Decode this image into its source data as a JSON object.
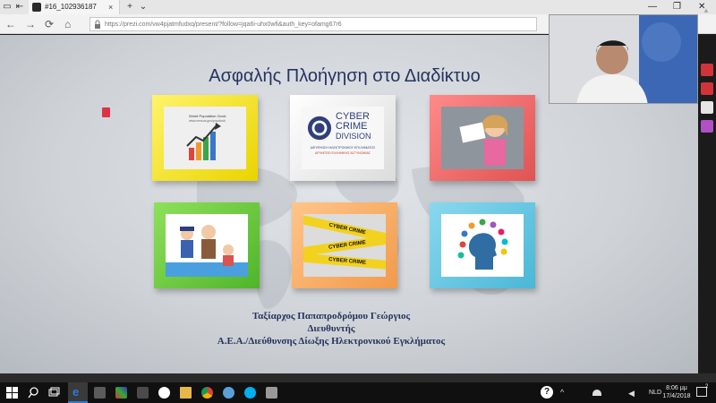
{
  "browser": {
    "tab_title": "#16_102936187",
    "tab_close": "×",
    "new_tab": "+",
    "tab_menu": "⌄",
    "url": "https://prezi.com/vw4pjatmfudxq/present/?follow=jqa6i-uhx0wfi&auth_key=ofamg67r6",
    "win_minimize": "—",
    "win_maximize": "❐",
    "win_close": "✕",
    "nav_back": "←",
    "nav_forward": "→",
    "nav_refresh": "⟳",
    "nav_home": "⌂",
    "bookmark_star": "☆"
  },
  "slide": {
    "title": "Ασφαλής Πλοήγηση στο Διαδίκτυο",
    "frame1": {
      "title": "World Population Clock",
      "subtitle": "www.census.gov/popclock"
    },
    "frame2": {
      "line1": "CYBER",
      "line2": "CRIME",
      "line3": "DIVISION",
      "line4": "ΔΙΕΥΘΥΝΣΗ ΗΛΕΚΤΡΟΝΙΚΟΥ ΕΓΚΛΗΜΑΤΟΣ",
      "line5": "ΑΡΧΗΓΕΙΟ ΕΛΛΗΝΙΚΗΣ ΑΣΤΥΝΟΜΙΑΣ"
    },
    "frame5": {
      "tape1": "CYBER CRIME",
      "tape2": "CYBER CRIME",
      "tape3": "CYBER CRIME"
    },
    "caption_name": "Ταξίαρχος Παπαπροδρόμου Γεώργιος",
    "caption_role": "Διευθυντής",
    "caption_org": "Α.Ε.Α./Διεύθυνσης Δίωξης Ηλεκτρονικού Εγκλήματος"
  },
  "taskbar": {
    "language": "NLD",
    "time": "8:06 μμ",
    "date": "17/4/2018",
    "help_icon": "?",
    "up_arrow": "^",
    "notif_count": "2"
  },
  "colors": {
    "title": "#27335f",
    "frame_yellow": "#f1dd1a",
    "frame_white": "#efefef",
    "frame_red": "#ec6b6b",
    "frame_green": "#5fc23a",
    "frame_orange": "#f4a75a",
    "frame_cyan": "#5cc2df",
    "edge_blue": "#2d7ad6"
  }
}
